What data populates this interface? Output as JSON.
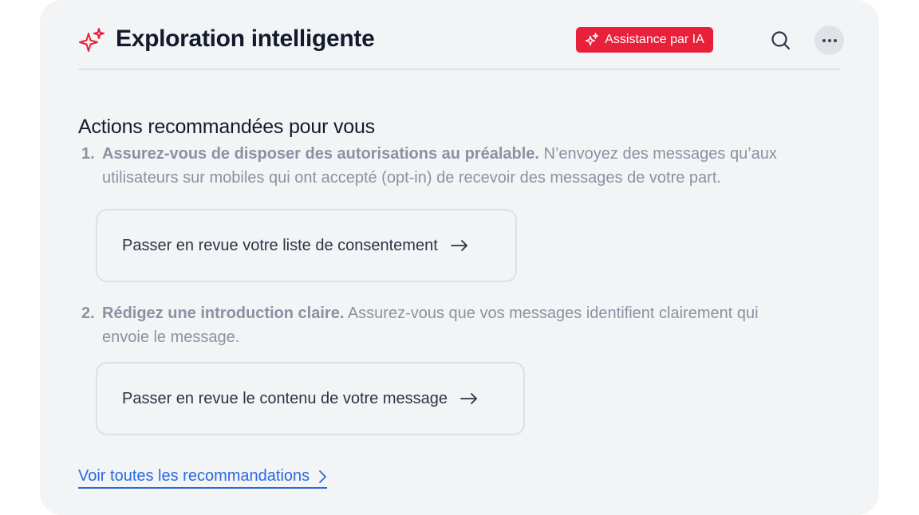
{
  "header": {
    "title": "Exploration intelligente",
    "ai_badge_label": "Assistance par IA",
    "icons": [
      "sparkle-icon",
      "search-icon",
      "more-horizontal-icon"
    ]
  },
  "section": {
    "title": "Actions recommandées pour vous",
    "steps": [
      {
        "number": "1.",
        "bold": "Assurez-vous de disposer des autorisations au préalable.",
        "text": " N’envoyez des messages qu’aux utilisateurs sur mobiles qui ont accepté (opt-in) de recevoir des messages de votre part.",
        "action_label": "Passer en revue votre liste de consentement"
      },
      {
        "number": "2.",
        "bold": "Rédigez une introduction claire.",
        "text": " Assurez-vous que vos messages identifient clairement qui envoie le message.",
        "action_label": "Passer en revue le contenu de votre message"
      }
    ]
  },
  "footer": {
    "see_all_label": "Voir toutes les recommandations"
  },
  "colors": {
    "accent": "#e8203a",
    "link": "#2a6ae0",
    "card_bg": "#f2f4f6"
  }
}
